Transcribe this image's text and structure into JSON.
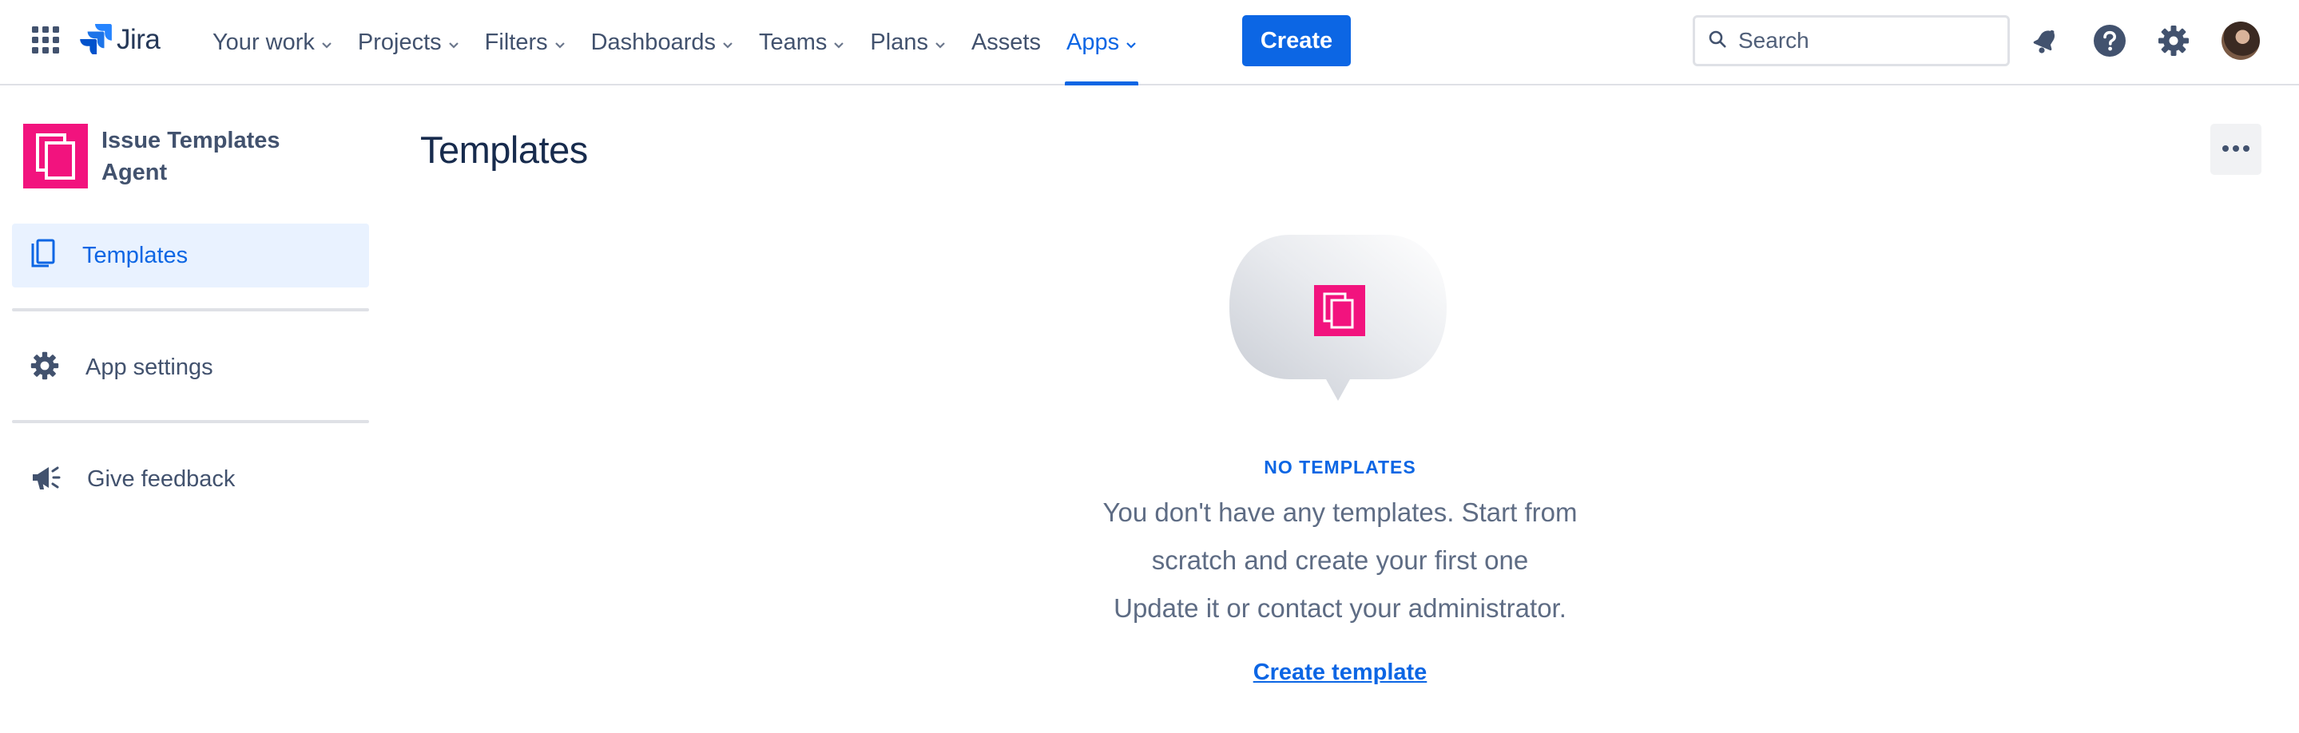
{
  "topnav": {
    "logo_text": "Jira",
    "items": [
      {
        "label": "Your work",
        "dropdown": true
      },
      {
        "label": "Projects",
        "dropdown": true
      },
      {
        "label": "Filters",
        "dropdown": true
      },
      {
        "label": "Dashboards",
        "dropdown": true
      },
      {
        "label": "Teams",
        "dropdown": true
      },
      {
        "label": "Plans",
        "dropdown": true
      },
      {
        "label": "Assets",
        "dropdown": false
      },
      {
        "label": "Apps",
        "dropdown": true,
        "active": true
      }
    ],
    "create_label": "Create",
    "search_placeholder": "Search",
    "icons": [
      "notifications-icon",
      "help-icon",
      "settings-icon",
      "avatar"
    ]
  },
  "sidebar": {
    "app_title": "Issue Templates Agent",
    "items": [
      {
        "label": "Templates",
        "icon": "templates-icon",
        "selected": true
      },
      {
        "label": "App settings",
        "icon": "gear-icon"
      },
      {
        "label": "Give feedback",
        "icon": "megaphone-icon"
      }
    ]
  },
  "main": {
    "title": "Templates",
    "empty_state": {
      "heading": "NO TEMPLATES",
      "lines": [
        "You don't have any templates. Start from",
        "scratch and create your first one",
        "Update it or contact your administrator."
      ],
      "link_label": "Create template"
    }
  },
  "colors": {
    "accent": "#0c66e4",
    "brand_pink": "#f2137e",
    "text_primary": "#172b4d",
    "text_secondary": "#42526e",
    "selected_bg": "#e9f2ff"
  }
}
